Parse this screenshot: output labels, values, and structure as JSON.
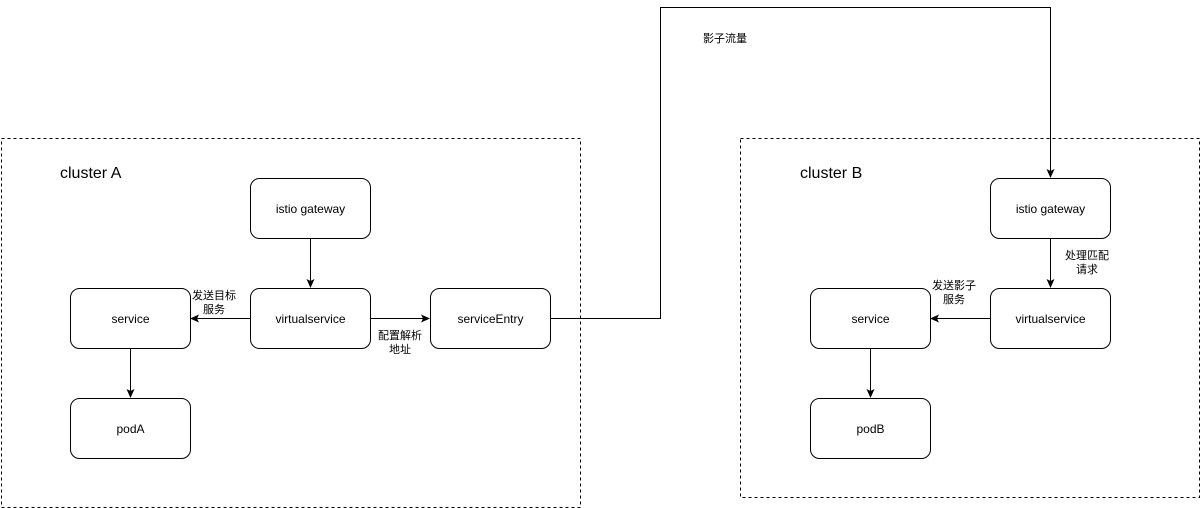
{
  "clusters": {
    "a": {
      "label": "cluster A"
    },
    "b": {
      "label": "cluster B"
    }
  },
  "nodes": {
    "a_gateway": "istio gateway",
    "a_service": "service",
    "a_virtualservice": "virtualservice",
    "a_serviceentry": "serviceEntry",
    "a_pod": "podA",
    "b_gateway": "istio gateway",
    "b_service": "service",
    "b_virtualservice": "virtualservice",
    "b_pod": "podB"
  },
  "edge_labels": {
    "shadow_traffic": "影子流量",
    "a_send_target": [
      "发送目标",
      "服务"
    ],
    "a_config_resolve": [
      "配置解析",
      "地址"
    ],
    "b_handle_match": [
      "处理匹配",
      "请求"
    ],
    "b_send_shadow": [
      "发送影子",
      "服务"
    ]
  }
}
